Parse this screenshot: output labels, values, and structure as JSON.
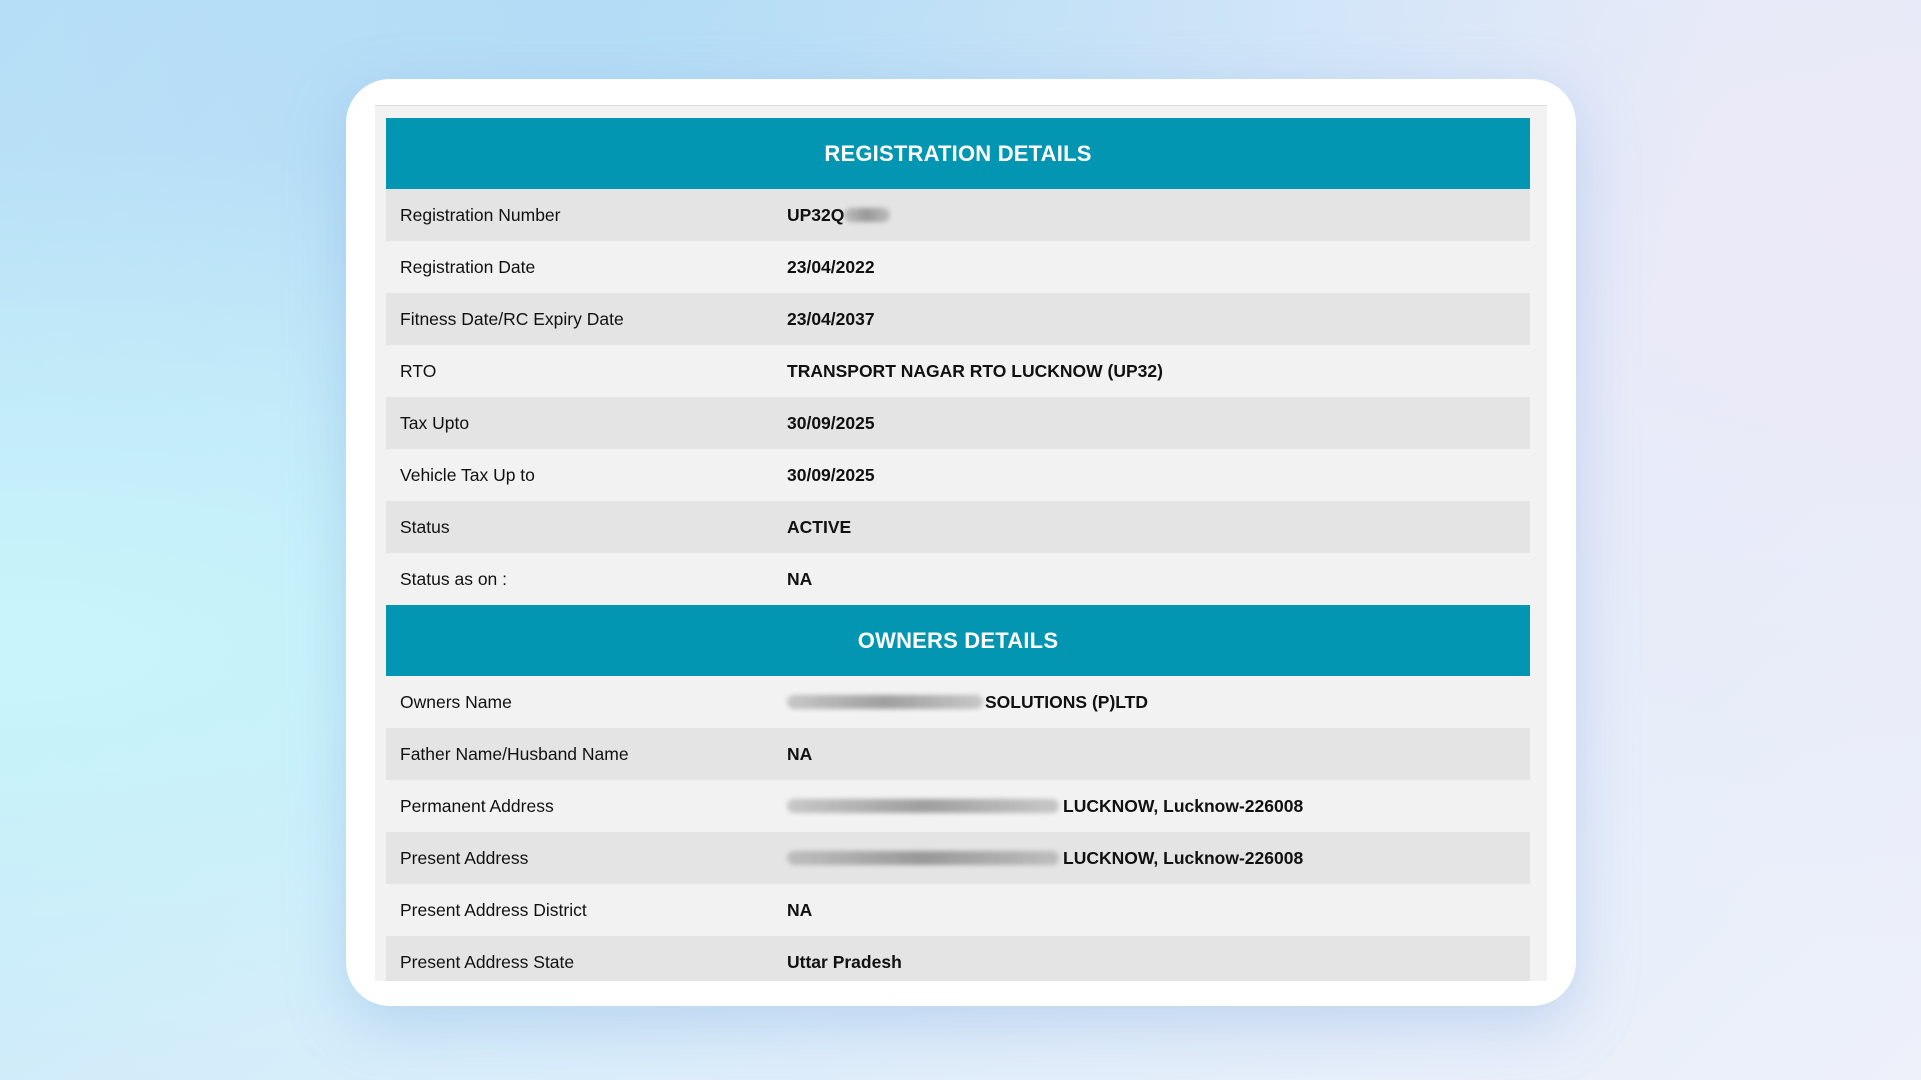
{
  "registration": {
    "title": "REGISTRATION DETAILS",
    "rows": [
      {
        "label": "Registration Number",
        "value": "UP32Q"
      },
      {
        "label": "Registration Date",
        "value": "23/04/2022"
      },
      {
        "label": "Fitness Date/RC Expiry Date",
        "value": "23/04/2037"
      },
      {
        "label": "RTO",
        "value": "TRANSPORT NAGAR RTO LUCKNOW (UP32)"
      },
      {
        "label": "Tax Upto",
        "value": "30/09/2025"
      },
      {
        "label": "Vehicle Tax Up to",
        "value": "30/09/2025"
      },
      {
        "label": "Status",
        "value": "ACTIVE"
      },
      {
        "label": "Status as on :",
        "value": "NA"
      }
    ]
  },
  "owners": {
    "title": "OWNERS DETAILS",
    "rows": [
      {
        "label": "Owners Name",
        "value": "SOLUTIONS (P)LTD"
      },
      {
        "label": "Father Name/Husband Name",
        "value": "NA"
      },
      {
        "label": "Permanent Address",
        "value": "LUCKNOW, Lucknow-226008"
      },
      {
        "label": "Present Address",
        "value": "LUCKNOW, Lucknow-226008"
      },
      {
        "label": "Present Address District",
        "value": "NA"
      },
      {
        "label": "Present Address State",
        "value": "Uttar Pradesh"
      }
    ]
  },
  "colors": {
    "header_bg": "#0396b3",
    "row_shaded": "#e4e4e4",
    "row_plain": "#f2f2f2"
  }
}
